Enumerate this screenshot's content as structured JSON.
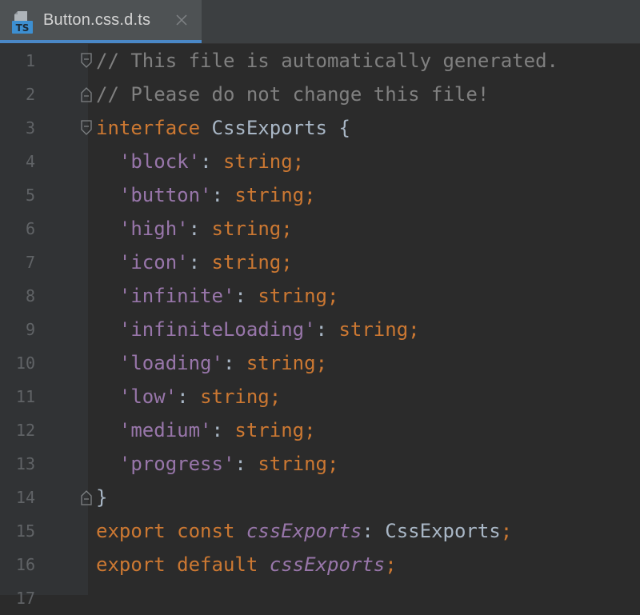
{
  "tab": {
    "icon_text": "TS",
    "label": "Button.css.d.ts"
  },
  "colors": {
    "comment": "#808080",
    "keyword": "#cc7832",
    "string": "#9876aa",
    "default": "#a9b7c6",
    "line_number": "#606366",
    "background": "#2b2b2b",
    "gutter": "#313335",
    "tab_accent": "#4a88c7"
  },
  "lines": [
    {
      "number": "1",
      "fold": "start",
      "tokens": [
        {
          "t": "// This file is automatically generated.",
          "c": "comment"
        }
      ]
    },
    {
      "number": "2",
      "fold": "end",
      "tokens": [
        {
          "t": "// Please do not change this file!",
          "c": "comment"
        }
      ]
    },
    {
      "number": "3",
      "fold": "start",
      "tokens": [
        {
          "t": "interface",
          "c": "keyword"
        },
        {
          "t": " ",
          "c": "punct"
        },
        {
          "t": "CssExports",
          "c": "type"
        },
        {
          "t": " {",
          "c": "brace"
        }
      ]
    },
    {
      "number": "4",
      "tokens": [
        {
          "t": "  ",
          "c": "punct"
        },
        {
          "t": "'block'",
          "c": "string"
        },
        {
          "t": ": ",
          "c": "punct"
        },
        {
          "t": "string",
          "c": "keyword"
        },
        {
          "t": ";",
          "c": "semi"
        }
      ]
    },
    {
      "number": "5",
      "tokens": [
        {
          "t": "  ",
          "c": "punct"
        },
        {
          "t": "'button'",
          "c": "string"
        },
        {
          "t": ": ",
          "c": "punct"
        },
        {
          "t": "string",
          "c": "keyword"
        },
        {
          "t": ";",
          "c": "semi"
        }
      ]
    },
    {
      "number": "6",
      "tokens": [
        {
          "t": "  ",
          "c": "punct"
        },
        {
          "t": "'high'",
          "c": "string"
        },
        {
          "t": ": ",
          "c": "punct"
        },
        {
          "t": "string",
          "c": "keyword"
        },
        {
          "t": ";",
          "c": "semi"
        }
      ]
    },
    {
      "number": "7",
      "tokens": [
        {
          "t": "  ",
          "c": "punct"
        },
        {
          "t": "'icon'",
          "c": "string"
        },
        {
          "t": ": ",
          "c": "punct"
        },
        {
          "t": "string",
          "c": "keyword"
        },
        {
          "t": ";",
          "c": "semi"
        }
      ]
    },
    {
      "number": "8",
      "tokens": [
        {
          "t": "  ",
          "c": "punct"
        },
        {
          "t": "'infinite'",
          "c": "string"
        },
        {
          "t": ": ",
          "c": "punct"
        },
        {
          "t": "string",
          "c": "keyword"
        },
        {
          "t": ";",
          "c": "semi"
        }
      ]
    },
    {
      "number": "9",
      "tokens": [
        {
          "t": "  ",
          "c": "punct"
        },
        {
          "t": "'infiniteLoading'",
          "c": "string"
        },
        {
          "t": ": ",
          "c": "punct"
        },
        {
          "t": "string",
          "c": "keyword"
        },
        {
          "t": ";",
          "c": "semi"
        }
      ]
    },
    {
      "number": "10",
      "tokens": [
        {
          "t": "  ",
          "c": "punct"
        },
        {
          "t": "'loading'",
          "c": "string"
        },
        {
          "t": ": ",
          "c": "punct"
        },
        {
          "t": "string",
          "c": "keyword"
        },
        {
          "t": ";",
          "c": "semi"
        }
      ]
    },
    {
      "number": "11",
      "tokens": [
        {
          "t": "  ",
          "c": "punct"
        },
        {
          "t": "'low'",
          "c": "string"
        },
        {
          "t": ": ",
          "c": "punct"
        },
        {
          "t": "string",
          "c": "keyword"
        },
        {
          "t": ";",
          "c": "semi"
        }
      ]
    },
    {
      "number": "12",
      "tokens": [
        {
          "t": "  ",
          "c": "punct"
        },
        {
          "t": "'medium'",
          "c": "string"
        },
        {
          "t": ": ",
          "c": "punct"
        },
        {
          "t": "string",
          "c": "keyword"
        },
        {
          "t": ";",
          "c": "semi"
        }
      ]
    },
    {
      "number": "13",
      "tokens": [
        {
          "t": "  ",
          "c": "punct"
        },
        {
          "t": "'progress'",
          "c": "string"
        },
        {
          "t": ": ",
          "c": "punct"
        },
        {
          "t": "string",
          "c": "keyword"
        },
        {
          "t": ";",
          "c": "semi"
        }
      ]
    },
    {
      "number": "14",
      "fold": "end",
      "tokens": [
        {
          "t": "}",
          "c": "brace"
        }
      ]
    },
    {
      "number": "15",
      "tokens": [
        {
          "t": "export",
          "c": "keyword"
        },
        {
          "t": " ",
          "c": "punct"
        },
        {
          "t": "const",
          "c": "keyword"
        },
        {
          "t": " ",
          "c": "punct"
        },
        {
          "t": "cssExports",
          "c": "ident-italic"
        },
        {
          "t": ": ",
          "c": "punct"
        },
        {
          "t": "CssExports",
          "c": "type"
        },
        {
          "t": ";",
          "c": "semi"
        }
      ]
    },
    {
      "number": "16",
      "tokens": [
        {
          "t": "export",
          "c": "keyword"
        },
        {
          "t": " ",
          "c": "punct"
        },
        {
          "t": "default",
          "c": "keyword"
        },
        {
          "t": " ",
          "c": "punct"
        },
        {
          "t": "cssExports",
          "c": "ident-italic"
        },
        {
          "t": ";",
          "c": "semi"
        }
      ]
    },
    {
      "number": "17",
      "tokens": []
    }
  ]
}
